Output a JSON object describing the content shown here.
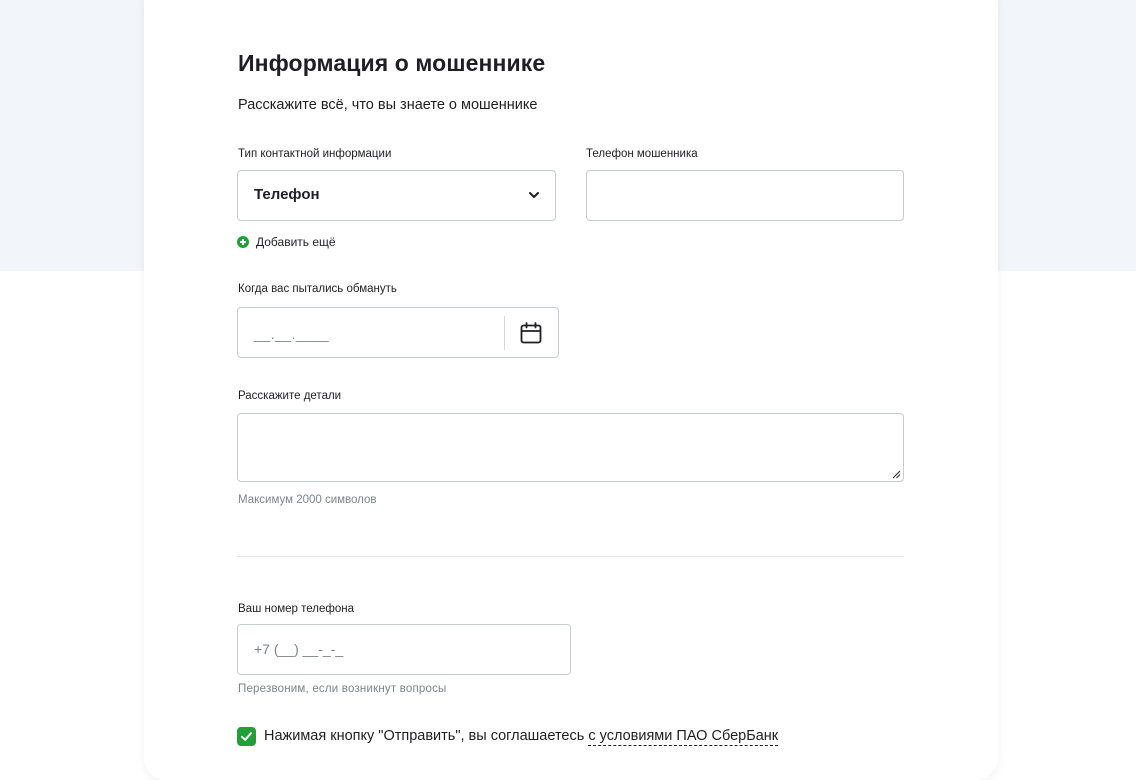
{
  "form": {
    "title": "Информация о мошеннике",
    "subtitle": "Расскажите всё, что вы знаете о мошеннике",
    "contact_type": {
      "label": "Тип контактной информации",
      "value": "Телефон"
    },
    "fraud_phone": {
      "label": "Телефон мошенника",
      "value": ""
    },
    "add_more": "Добавить ещё",
    "date": {
      "label": "Когда вас пытались обмануть",
      "placeholder": "__.__.____"
    },
    "details": {
      "label": "Расскажите детали",
      "value": "",
      "hint": "Максимум 2000 символов"
    },
    "your_phone": {
      "label": "Ваш номер телефона",
      "placeholder": "+7 (__) __-_-_",
      "hint": "Перезвоним, если возникнут вопросы"
    },
    "consent": {
      "checked": true,
      "text": "Нажимая кнопку \"Отправить\", вы соглашаетесь ",
      "link": "с условиями ПАО СберБанк"
    }
  },
  "colors": {
    "accent": "#21a038",
    "header_bg": "#f2f5f9",
    "border": "#c7ccd1",
    "hint": "#7d838a"
  },
  "icons": {
    "select": "chevron-down-icon",
    "date": "calendar-icon",
    "add": "plus-circle-icon",
    "resize": "resize-handle-icon",
    "check": "checkmark-icon"
  }
}
